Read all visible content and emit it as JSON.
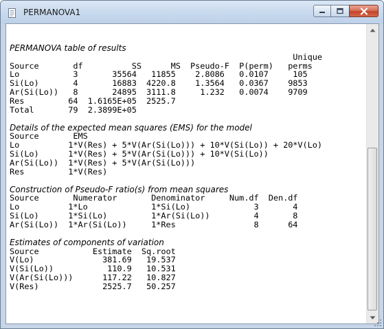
{
  "window": {
    "title": "PERMANOVA1"
  },
  "output": [
    {
      "kind": "blank",
      "text": ""
    },
    {
      "kind": "section",
      "text": "PERMANOVA table of results"
    },
    {
      "kind": "row",
      "text": "                                                          Unique"
    },
    {
      "kind": "row",
      "text": "Source       df          SS      MS  Pseudo-F  P(perm)   perms"
    },
    {
      "kind": "row",
      "text": "Lo           3       35564   11855    2.8086   0.0107     105"
    },
    {
      "kind": "row",
      "text": "Si(Lo)       4       16883  4220.8    1.3564   0.0367    9853"
    },
    {
      "kind": "row",
      "text": "Ar(Si(Lo))   8       24895  3111.8     1.232   0.0074    9709"
    },
    {
      "kind": "row",
      "text": "Res         64  1.6165E+05  2525.7"
    },
    {
      "kind": "row",
      "text": "Total       79  2.3899E+05"
    },
    {
      "kind": "blank",
      "text": ""
    },
    {
      "kind": "section",
      "text": "Details of the expected mean squares (EMS) for the model"
    },
    {
      "kind": "row",
      "text": "Source       EMS"
    },
    {
      "kind": "row",
      "text": "Lo          1*V(Res) + 5*V(Ar(Si(Lo))) + 10*V(Si(Lo)) + 20*V(Lo)"
    },
    {
      "kind": "row",
      "text": "Si(Lo)      1*V(Res) + 5*V(Ar(Si(Lo))) + 10*V(Si(Lo))"
    },
    {
      "kind": "row",
      "text": "Ar(Si(Lo))  1*V(Res) + 5*V(Ar(Si(Lo)))"
    },
    {
      "kind": "row",
      "text": "Res         1*V(Res)"
    },
    {
      "kind": "blank",
      "text": ""
    },
    {
      "kind": "section",
      "text": "Construction of Pseudo-F ratio(s) from mean squares"
    },
    {
      "kind": "row",
      "text": "Source       Numerator       Denominator     Num.df  Den.df"
    },
    {
      "kind": "row",
      "text": "Lo          1*Lo             1*Si(Lo)             3       4"
    },
    {
      "kind": "row",
      "text": "Si(Lo)      1*Si(Lo)         1*Ar(Si(Lo))         4       8"
    },
    {
      "kind": "row",
      "text": "Ar(Si(Lo))  1*Ar(Si(Lo))     1*Res                8      64"
    },
    {
      "kind": "blank",
      "text": ""
    },
    {
      "kind": "section",
      "text": "Estimates of components of variation"
    },
    {
      "kind": "row",
      "text": "Source           Estimate  Sq.root"
    },
    {
      "kind": "row",
      "text": "V(Lo)              381.69   19.537"
    },
    {
      "kind": "row",
      "text": "V(Si(Lo))           110.9   10.531"
    },
    {
      "kind": "row",
      "text": "V(Ar(Si(Lo)))      117.22   10.827"
    },
    {
      "kind": "row",
      "text": "V(Res)             2525.7   50.257"
    }
  ]
}
